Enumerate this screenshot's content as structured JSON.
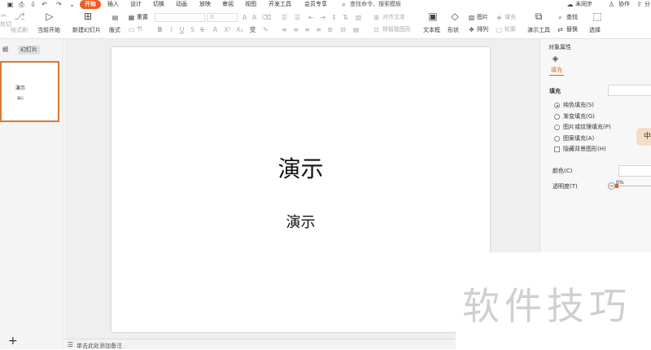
{
  "menubar": {
    "items": [
      "开始",
      "插入",
      "设计",
      "切换",
      "动画",
      "放映",
      "审阅",
      "视图",
      "开发工具",
      "会员专享"
    ],
    "active": "开始",
    "search_placeholder": "查找命令、搜索模板",
    "sync_label": "未同步",
    "collab_label": "协作",
    "share_label": "分"
  },
  "ribbon": {
    "cut_label": "剪切",
    "format_painter_label": "格式刷",
    "play_from_current_label": "当前开始",
    "new_slide_label": "新建幻灯片",
    "layout_label": "版式",
    "section_label": "节",
    "reset_label": "重置",
    "font_size_value": "0",
    "align_text_label": "对齐文本",
    "smartart_label": "转智能图形",
    "textbox_label": "文本框",
    "shape_label": "形状",
    "picture_label": "图片",
    "fill_label": "填充",
    "arrange_label": "排列",
    "outline_label": "轮廓",
    "presentation_tools_label": "演示工具",
    "find_label": "查找",
    "replace_label": "替换",
    "select_label": "选择"
  },
  "leftpane": {
    "tab_outline": "纲",
    "tab_slides": "幻灯片",
    "thumb_title": "演示",
    "thumb_subtitle": "演示",
    "add_label": "+"
  },
  "slide": {
    "title": "演示",
    "subtitle": "演示"
  },
  "notes": {
    "placeholder": "单击此处添加备注"
  },
  "rightpane": {
    "header": "对象属性",
    "tab_fill": "填充",
    "section_fill": "填充",
    "options": [
      {
        "label": "纯色填充(S)",
        "selected": true
      },
      {
        "label": "渐变填充(G)",
        "selected": false
      },
      {
        "label": "图片或纹理填充(P)",
        "selected": false
      },
      {
        "label": "图案填充(A)",
        "selected": false
      }
    ],
    "hide_bg_label": "隐藏背景图形(H)",
    "color_label": "颜色(C)",
    "transparency_label": "透明度(T)",
    "transparency_value": "0%",
    "float_button_label": "中"
  },
  "watermark": {
    "text": "软件技巧"
  },
  "colors": {
    "accent": "#f15a24",
    "thumb_border": "#d97a35"
  }
}
